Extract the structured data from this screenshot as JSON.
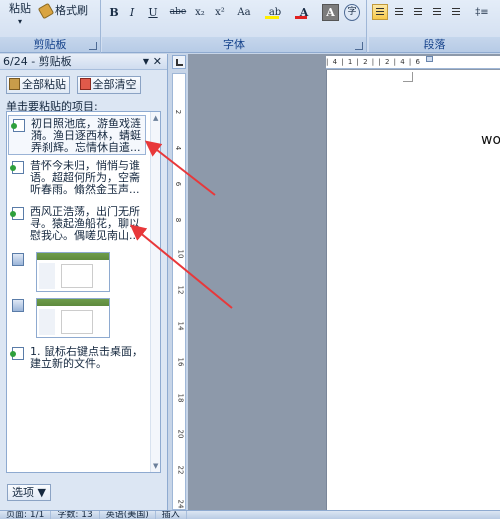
{
  "ribbon": {
    "clipboard": {
      "paste_label": "粘贴",
      "format_painter_label": "格式刷",
      "group_label": "剪贴板"
    },
    "font": {
      "group_label": "字体",
      "buttons": [
        "B",
        "I",
        "U",
        "abe",
        "x₂",
        "x²",
        "Aa",
        "ab",
        "A",
        "A",
        "字"
      ]
    },
    "paragraph": {
      "group_label": "段落",
      "extra_label": "‡≡"
    }
  },
  "pane": {
    "title": "6/24 - 剪贴板",
    "paste_all": "全部粘贴",
    "clear_all": "全部清空",
    "caption": "单击要粘贴的项目:",
    "items": [
      {
        "type": "text",
        "text": "初日照池底，游鱼戏涟漪。渔日逐西林，蜻蜓弄刹辉。忘情休自遣..."
      },
      {
        "type": "text",
        "text": "昔怀今未归，悄悄与谁语。超超何所为，空斋听春雨。翛然金玉声..."
      },
      {
        "type": "text",
        "text": "西风正浩荡，出门无所寻。猿起渔船花，聊以慰我心。偶嗟见南山..."
      },
      {
        "type": "image"
      },
      {
        "type": "image"
      },
      {
        "type": "text",
        "text": "1. 鼠标右键点击桌面，建立新的文件。"
      }
    ],
    "options_label": "选项 ▼"
  },
  "ruler": {
    "h_label": "| 4 | 1 | 2 | | 2 | 4 | 6",
    "v_numbers": [
      "2",
      "4",
      "6",
      "8",
      "10",
      "12",
      "14",
      "16",
      "18",
      "20",
      "22",
      "24"
    ]
  },
  "document": {
    "visible_text": "wo"
  },
  "status": {
    "page": "页面: 1/1",
    "words": "字数: 13",
    "lang": "英语(美国)",
    "insert": "插入"
  }
}
